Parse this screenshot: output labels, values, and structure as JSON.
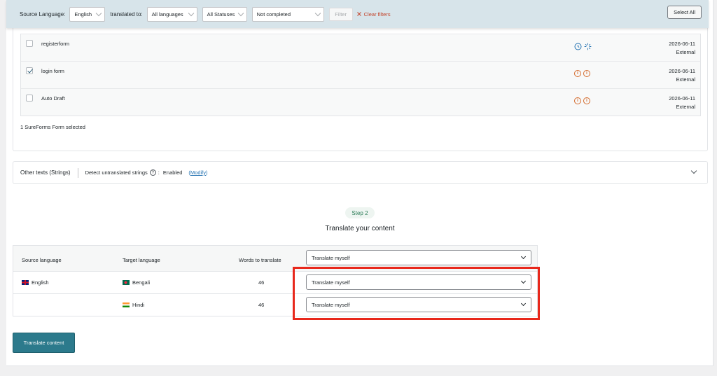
{
  "filter_bar": {
    "source_label": "Source Language:",
    "source_value": "English",
    "translated_label": "translated to:",
    "target_value": "All languages",
    "status_value": "All Statuses",
    "completion_value": "Not completed",
    "filter_label": "Filter",
    "clear_label": "Clear filters",
    "select_all_label": "Select All"
  },
  "items": [
    {
      "title": "registerform",
      "date": "2026-06-11",
      "source": "External",
      "checked": false,
      "status_icons": [
        "clock-icon",
        "spinner-icon"
      ]
    },
    {
      "title": "login form",
      "date": "2026-06-11",
      "source": "External",
      "checked": true,
      "status_icons": [
        "info-icon",
        "info-icon"
      ]
    },
    {
      "title": "Auto Draft",
      "date": "2026-06-11",
      "source": "External",
      "checked": false,
      "status_icons": [
        "info-icon",
        "info-icon"
      ]
    }
  ],
  "selected_info": "1 SureForms Form selected",
  "strings_panel": {
    "title": "Other texts (Strings)",
    "detect_label": "Detect untranslated strings",
    "colon": ":",
    "status": "Enabled",
    "modify_open": "(",
    "modify_label": "Modify",
    "modify_close": ")"
  },
  "step": {
    "pill": "Step 2",
    "title": "Translate your content"
  },
  "language_table": {
    "headers": {
      "source": "Source language",
      "target": "Target language",
      "words": "Words to translate",
      "method": "Translate myself"
    },
    "source_language": "English",
    "rows": [
      {
        "target": "Bengali",
        "words": "46",
        "method": "Translate myself"
      },
      {
        "target": "Hindi",
        "words": "46",
        "method": "Translate myself"
      }
    ]
  },
  "translate_button": "Translate content",
  "colors": {
    "filter_bar_bg": "#d7e4ea",
    "primary_button": "#2c7a8c",
    "highlight_border": "#e8281c",
    "link": "#2271b1",
    "info_icon": "#d46b2c",
    "clock_icon": "#2271b1"
  }
}
